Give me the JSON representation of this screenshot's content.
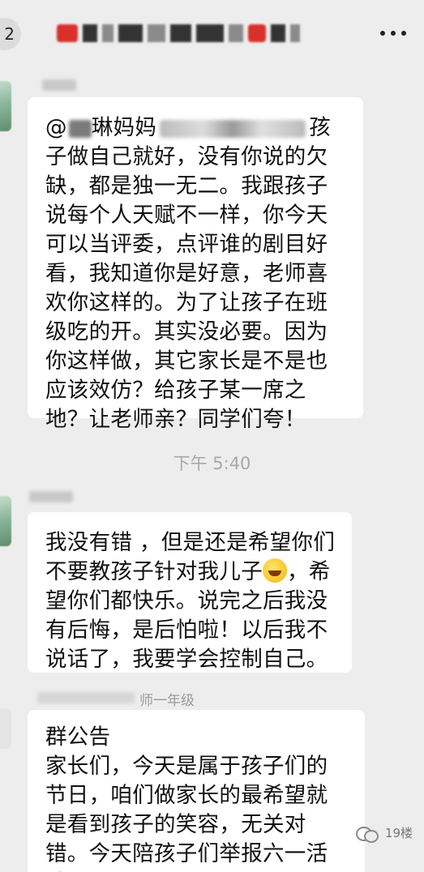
{
  "header": {
    "unread_badge": "2"
  },
  "messages": [
    {
      "mention_prefix": "@",
      "text": "孩子做自己就好，没有你说的欠缺，都是独一无二。我跟孩子说每个人天赋不一样，你今天可以当评委，点评谁的剧目好看，我知道你是好意，老师喜欢你这样的。为了让孩子在班级吃的开。其实没必要。因为你这样做，其它家长是不是也应该效仿？给孩子某一席之地？让老师亲？同学们夸！",
      "mention_visible": "琳妈妈",
      "mention_tail": "孩"
    },
    {
      "text_before_emoji": "我没有错 ，但是还是希望你们不要教孩子针对我儿子",
      "emoji": "laughing-tears-emoji",
      "text_after_emoji": "，希望你们都快乐。说完之后我没有后悔，是后怕啦！以后我不说话了，我要学会控制自己。"
    },
    {
      "sender_suffix": "师一年级",
      "title": "群公告",
      "text": "家长们，今天是属于孩子们的节日，咱们做家长的最希望就是看到孩子的笑容，无关对错。今天陪孩子们举报六一活动，"
    }
  ],
  "timestamp": "下午 5:40",
  "watermark": {
    "text": "19楼"
  },
  "colors": {
    "background": "#ededed",
    "bubble": "#ffffff",
    "timestamp": "#a8a8a8"
  }
}
